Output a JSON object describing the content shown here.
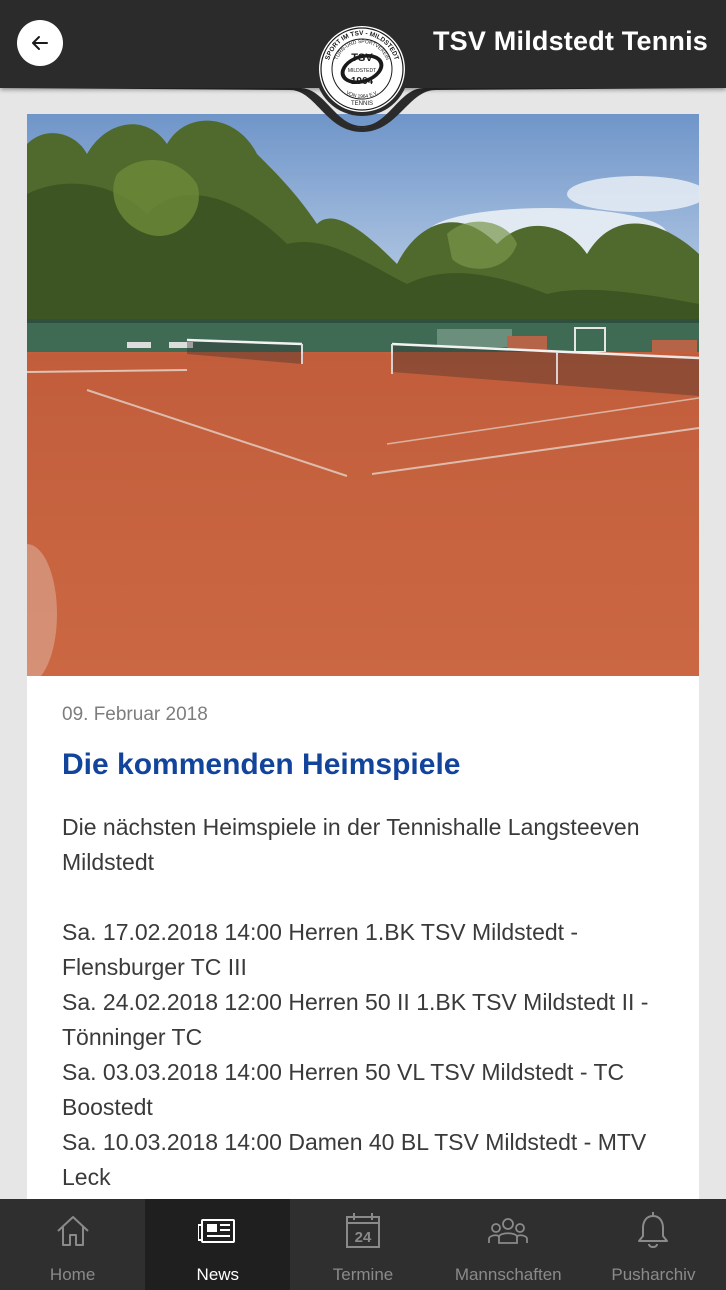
{
  "header": {
    "title": "TSV Mildstedt Tennis",
    "back_icon": "arrow-left-icon"
  },
  "logo": {
    "text_top": "SPORT IM TSV - MILDSTEDT",
    "text_ring": "TURN-UND SPORTVEREIN",
    "abbr": "TSV",
    "town": "MILDSTEDT",
    "year": "1964",
    "founded": "VON 1964 E.V.",
    "sport": "TENNIS"
  },
  "article": {
    "date": "09. Februar 2018",
    "title": "Die kommenden Heimspiele",
    "body": "Die nächsten Heimspiele in der Tennishalle Langsteeven Mildstedt\n\nSa. 17.02.2018 14:00 Herren 1.BK TSV Mildstedt - Flensburger TC III\nSa. 24.02.2018 12:00 Herren 50 II 1.BK TSV Mildstedt II - Tönninger TC\nSa. 03.03.2018 14:00 Herren 50 VL TSV Mildstedt - TC Boostedt\nSa. 10.03.2018 14:00 Damen 40 BL TSV Mildstedt - MTV Leck"
  },
  "nav": {
    "items": [
      {
        "label": "Home",
        "icon": "home-icon"
      },
      {
        "label": "News",
        "icon": "newspaper-icon",
        "active": true
      },
      {
        "label": "Termine",
        "icon": "calendar-icon",
        "day": "24"
      },
      {
        "label": "Mannschaften",
        "icon": "team-icon"
      },
      {
        "label": "Pusharchiv",
        "icon": "bell-icon"
      }
    ]
  },
  "colors": {
    "header_bg": "#2b2b2b",
    "headline": "#12449c",
    "nav_bg": "#2f2f2f",
    "nav_active_bg": "#1f1f1f",
    "clay": "#c9613d"
  }
}
